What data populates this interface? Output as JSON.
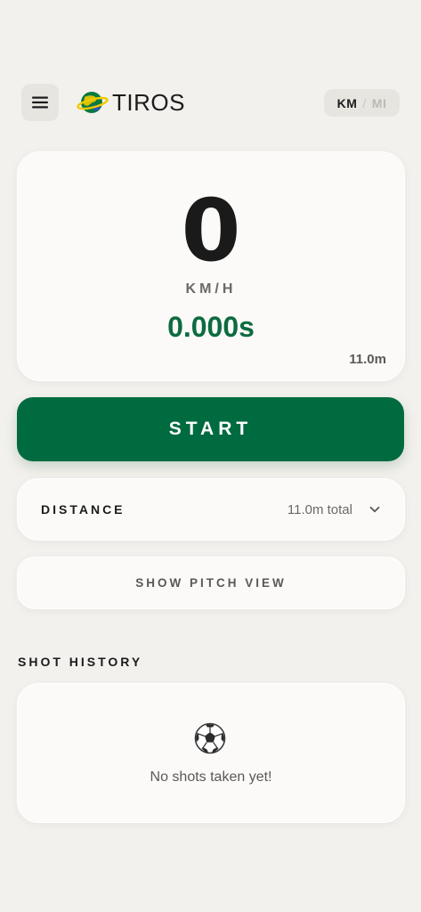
{
  "header": {
    "menu_icon": "hamburger-menu-icon",
    "logo_icon": "globe-ring-logo",
    "brand_name": "TIROS",
    "unit_toggle": {
      "active": "KM",
      "separator": "/",
      "inactive": "MI"
    }
  },
  "speed_card": {
    "speed": "0",
    "unit": "KM/H",
    "time": "0.000s",
    "distance": "11.0m"
  },
  "start_button": {
    "label": "START"
  },
  "distance_row": {
    "label": "DISTANCE",
    "value": "11.0m total",
    "icon": "chevron-down-icon"
  },
  "pitch_view": {
    "label": "SHOW PITCH VIEW"
  },
  "history": {
    "title": "SHOT HISTORY",
    "empty_icon": "soccer-ball-icon",
    "empty_text": "No shots taken yet!"
  },
  "colors": {
    "background": "#f3f1ed",
    "primary_green": "#006b3f",
    "time_green": "#0d6b40",
    "card": "#fbfaf8"
  }
}
